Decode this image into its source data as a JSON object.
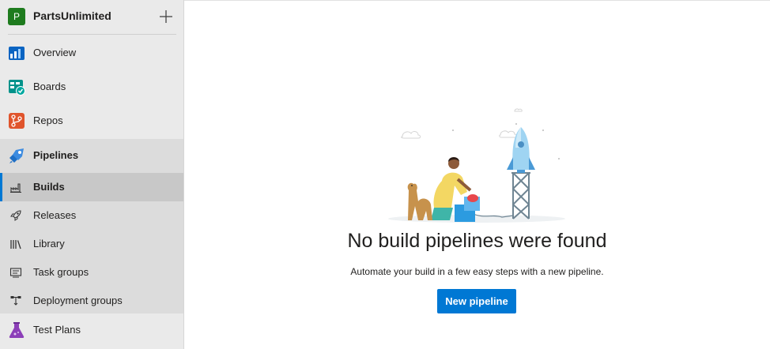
{
  "project": {
    "avatar_letter": "P",
    "name": "PartsUnlimited",
    "add_icon": "plus-icon"
  },
  "nav": {
    "overview": {
      "label": "Overview",
      "icon": "overview-icon"
    },
    "boards": {
      "label": "Boards",
      "icon": "boards-icon"
    },
    "repos": {
      "label": "Repos",
      "icon": "repos-icon"
    },
    "pipelines": {
      "label": "Pipelines",
      "icon": "pipelines-icon",
      "items": [
        {
          "label": "Builds",
          "icon": "builds-icon",
          "selected": true
        },
        {
          "label": "Releases",
          "icon": "rocket-icon"
        },
        {
          "label": "Library",
          "icon": "library-icon"
        },
        {
          "label": "Task groups",
          "icon": "task-groups-icon"
        },
        {
          "label": "Deployment groups",
          "icon": "deployment-groups-icon"
        }
      ]
    },
    "test_plans": {
      "label": "Test Plans",
      "icon": "test-plans-icon"
    }
  },
  "main": {
    "empty_title": "No build pipelines were found",
    "empty_description": "Automate your build in a few easy steps with a new pipeline.",
    "new_pipeline_label": "New pipeline"
  },
  "colors": {
    "accent": "#0078d4",
    "sidebar_bg": "#eaeaea",
    "project_avatar": "#1e7b1e"
  }
}
